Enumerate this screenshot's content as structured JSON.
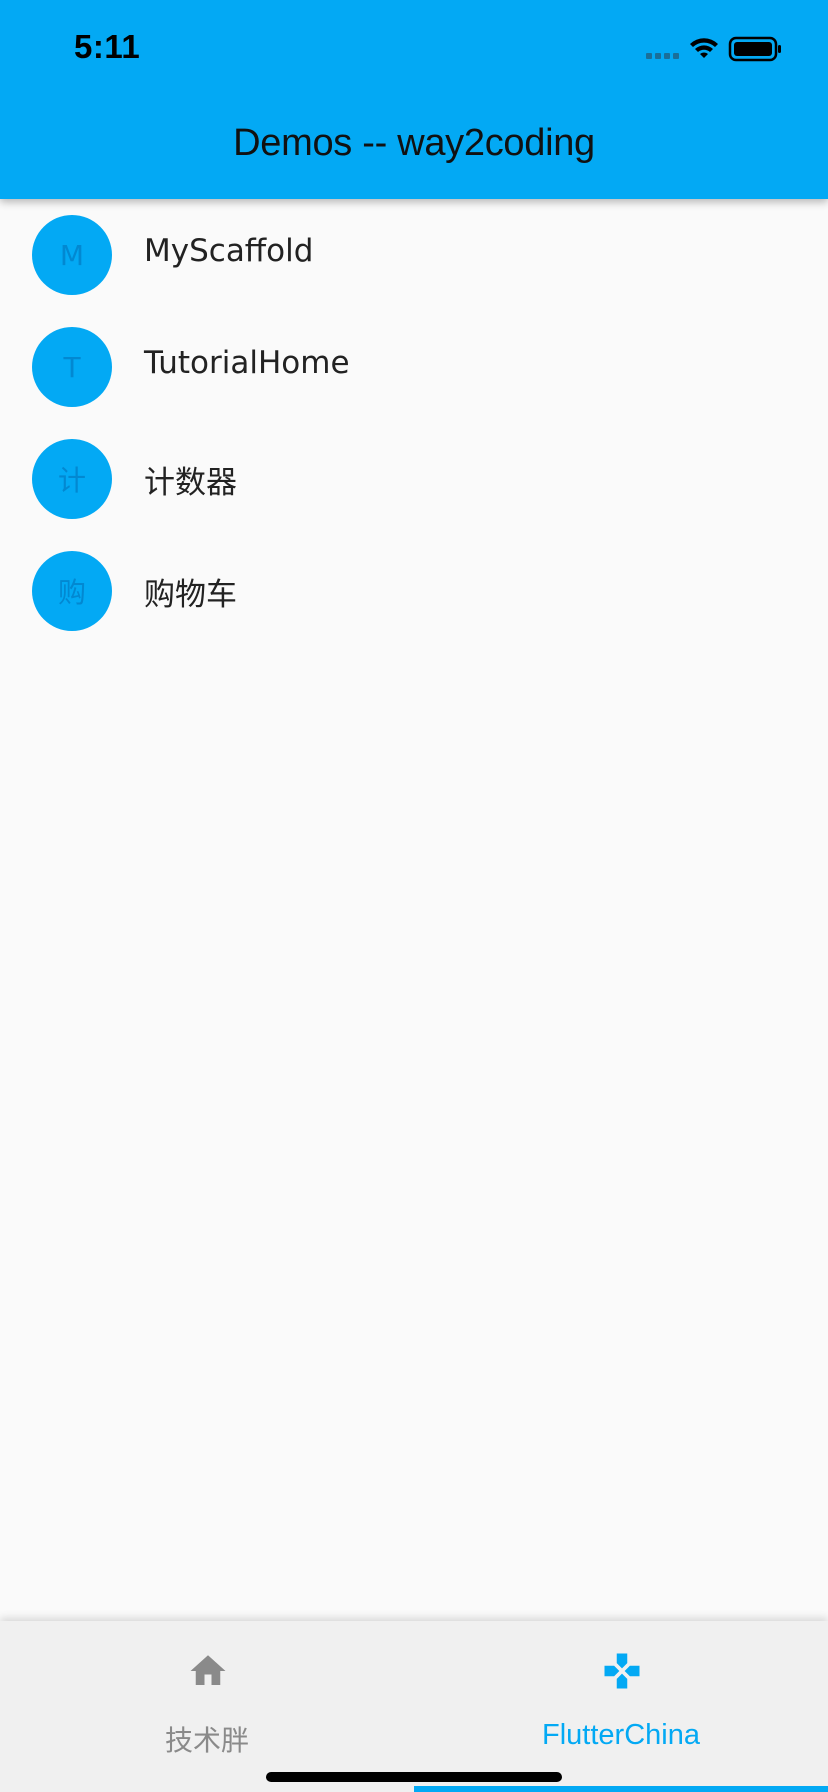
{
  "status_bar": {
    "time": "5:11",
    "icons": [
      "cellular-signal-icon",
      "wifi-icon",
      "battery-icon"
    ]
  },
  "app_bar": {
    "title": "Demos -- way2coding"
  },
  "list": {
    "items": [
      {
        "avatar": "M",
        "label": "MyScaffold"
      },
      {
        "avatar": "T",
        "label": "TutorialHome"
      },
      {
        "avatar": "计",
        "label": "计数器"
      },
      {
        "avatar": "购",
        "label": "购物车"
      }
    ]
  },
  "bottom_nav": {
    "tabs": [
      {
        "label": "技术胖",
        "icon": "home-icon",
        "active": false
      },
      {
        "label": "FlutterChina",
        "icon": "gamepad-icon",
        "active": true
      }
    ]
  },
  "colors": {
    "primary": "#03a9f4",
    "avatar_text": "#0288d1",
    "inactive": "#8a8a8a",
    "background": "#fafafa",
    "bottom_bar": "#f0f0f0"
  }
}
